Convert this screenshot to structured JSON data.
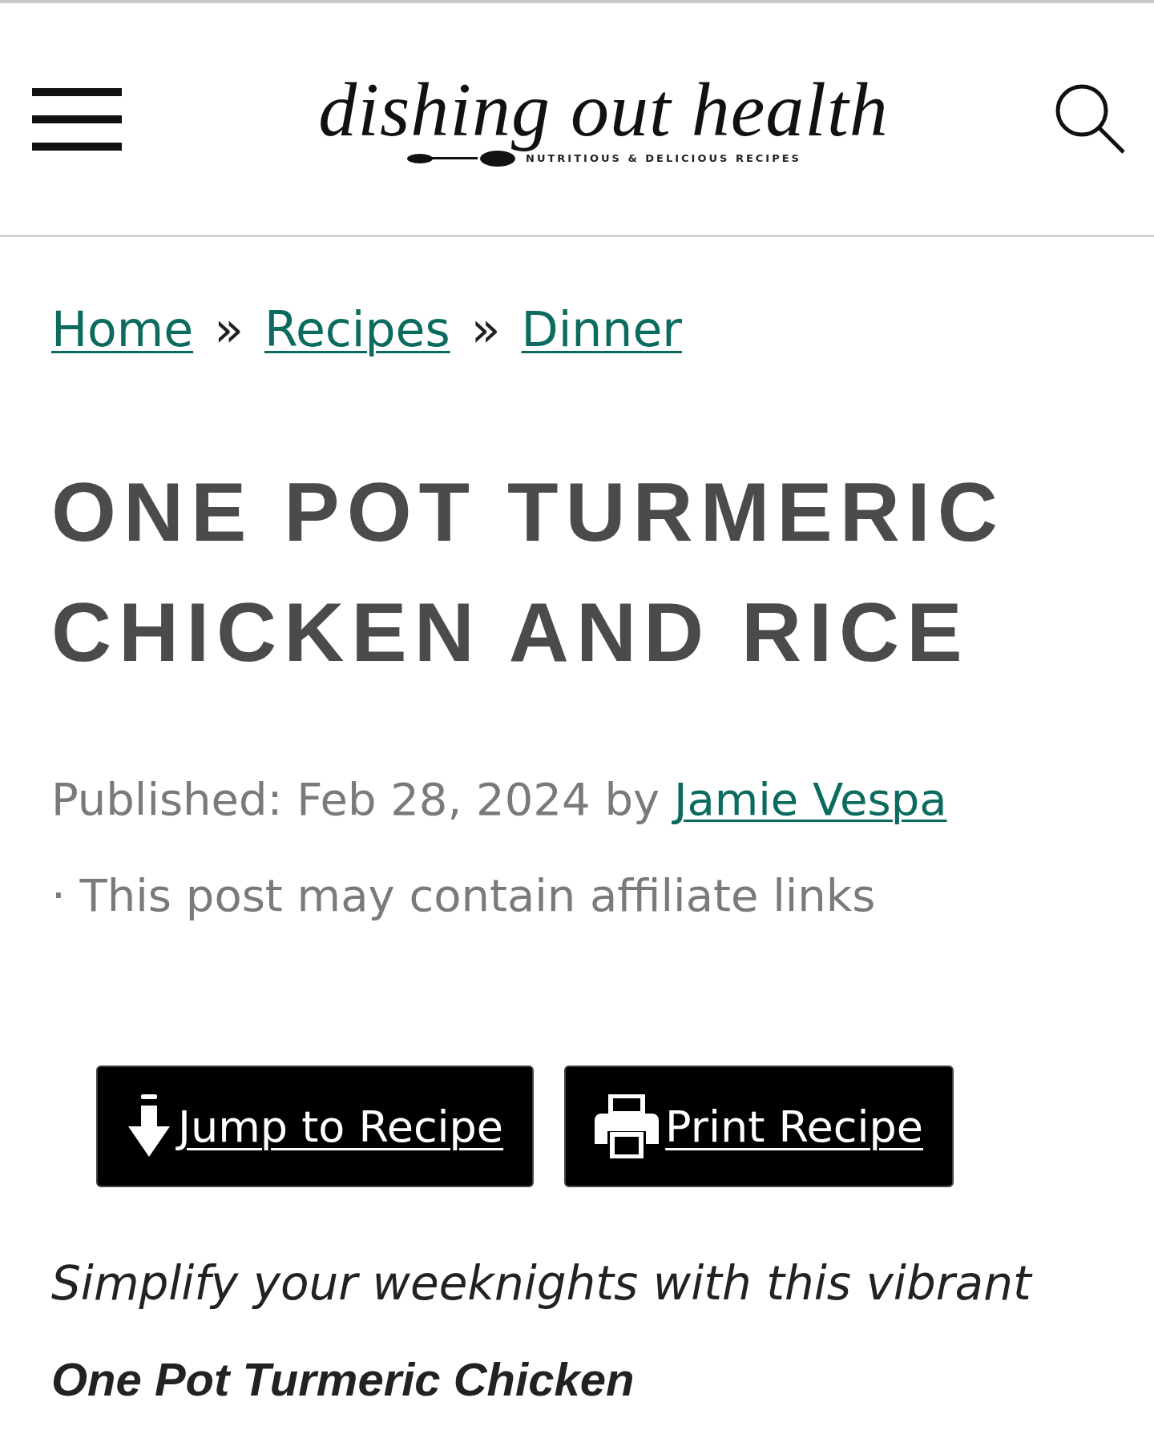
{
  "header": {
    "logo_title": "dishing out health",
    "logo_tagline": "NUTRITIOUS & DELICIOUS RECIPES"
  },
  "breadcrumbs": [
    {
      "kind": "link",
      "text": "Home"
    },
    {
      "kind": "separator",
      "text": "»"
    },
    {
      "kind": "link",
      "text": "Recipes"
    },
    {
      "kind": "separator",
      "text": "»"
    },
    {
      "kind": "link",
      "text": "Dinner"
    }
  ],
  "title": "ONE POT TURMERIC CHICKEN AND RICE",
  "byline": {
    "published": "Published: Feb 28, 2024 by",
    "author": "Jamie Vespa",
    "note": "· This post may contain affiliate links"
  },
  "buttons": [
    {
      "kind": "jump",
      "label": "Jump to Recipe"
    },
    {
      "kind": "print",
      "label": "Print Recipe"
    }
  ],
  "intro": "Simplify your weeknights with this vibrant **One Pot Turmeric Chicken**"
}
